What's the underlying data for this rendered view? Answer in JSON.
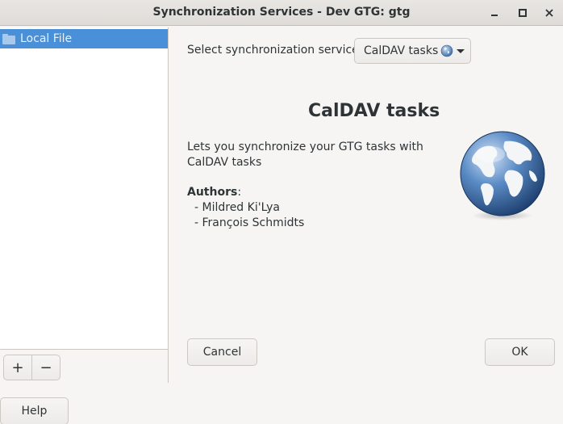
{
  "window": {
    "title": "Synchronization Services - Dev GTG: gtg"
  },
  "titlebar": {
    "minimize_icon": "minimize-icon",
    "maximize_icon": "maximize-icon",
    "close_glyph": "×"
  },
  "sidebar": {
    "items": [
      {
        "label": "Local File",
        "icon": "folder-icon",
        "selected": true
      }
    ],
    "add_glyph": "+",
    "remove_glyph": "−"
  },
  "main": {
    "select_label": "Select synchronization service:",
    "service_combo": {
      "value": "CalDAV tasks",
      "icon": "globe-icon"
    },
    "backend_title": "CalDAV tasks",
    "description": "Lets you synchronize your GTG tasks with CalDAV tasks",
    "authors_heading": "Authors",
    "authors_colon": ":",
    "authors": [
      "- Mildred Ki'Lya",
      "- François Schmidts"
    ],
    "cancel_label": "Cancel",
    "ok_label": "OK"
  },
  "footer": {
    "help_label": "Help"
  },
  "colors": {
    "selection": "#4a90d9",
    "window_bg": "#f6f5f4",
    "border": "#cdc7c2"
  }
}
